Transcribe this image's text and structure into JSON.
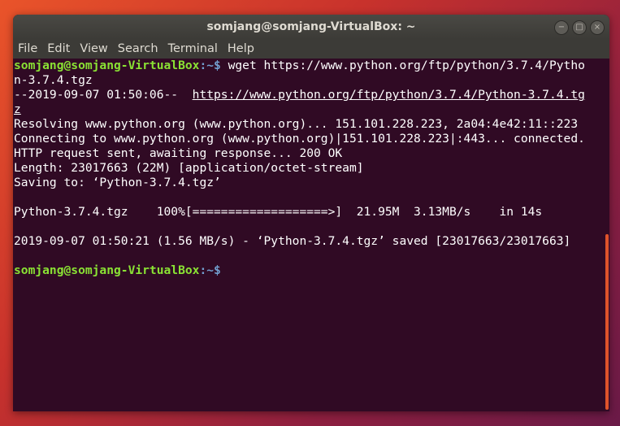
{
  "window": {
    "title": "somjang@somjang-VirtualBox: ~",
    "controls": {
      "minimize": "−",
      "maximize": "□",
      "close": "×"
    }
  },
  "menu": [
    "File",
    "Edit",
    "View",
    "Search",
    "Terminal",
    "Help"
  ],
  "terminal": {
    "prompt_user": "somjang@somjang-VirtualBox",
    "prompt_path": ":~$",
    "command": " wget https://www.python.org/ftp/python/3.7.4/Pytho",
    "command_wrap": "n-3.7.4.tgz",
    "timestamp_prefix": "--2019-09-07 01:50:06--  ",
    "url_part1": "https://www.python.org/ftp/python/3.7.4/Python-3.7.4.tg",
    "url_part2": "z",
    "resolving": "Resolving www.python.org (www.python.org)... 151.101.228.223, 2a04:4e42:11::223",
    "connecting": "Connecting to www.python.org (www.python.org)|151.101.228.223|:443... connected.",
    "http_request": "HTTP request sent, awaiting response... 200 OK",
    "length": "Length: 23017663 (22M) [application/octet-stream]",
    "saving": "Saving to: ‘Python-3.7.4.tgz’",
    "progress": "Python-3.7.4.tgz    100%[===================>]  21.95M  3.13MB/s    in 14s",
    "saved": "2019-09-07 01:50:21 (1.56 MB/s) - ‘Python-3.7.4.tgz’ saved [23017663/23017663]",
    "final_prompt_user": "somjang@somjang-VirtualBox",
    "final_prompt_path": ":~$"
  },
  "colors": {
    "terminal_bg": "#300a24",
    "prompt_user": "#8ae234",
    "prompt_path": "#729fcf",
    "scrollbar": "#e0532b"
  }
}
